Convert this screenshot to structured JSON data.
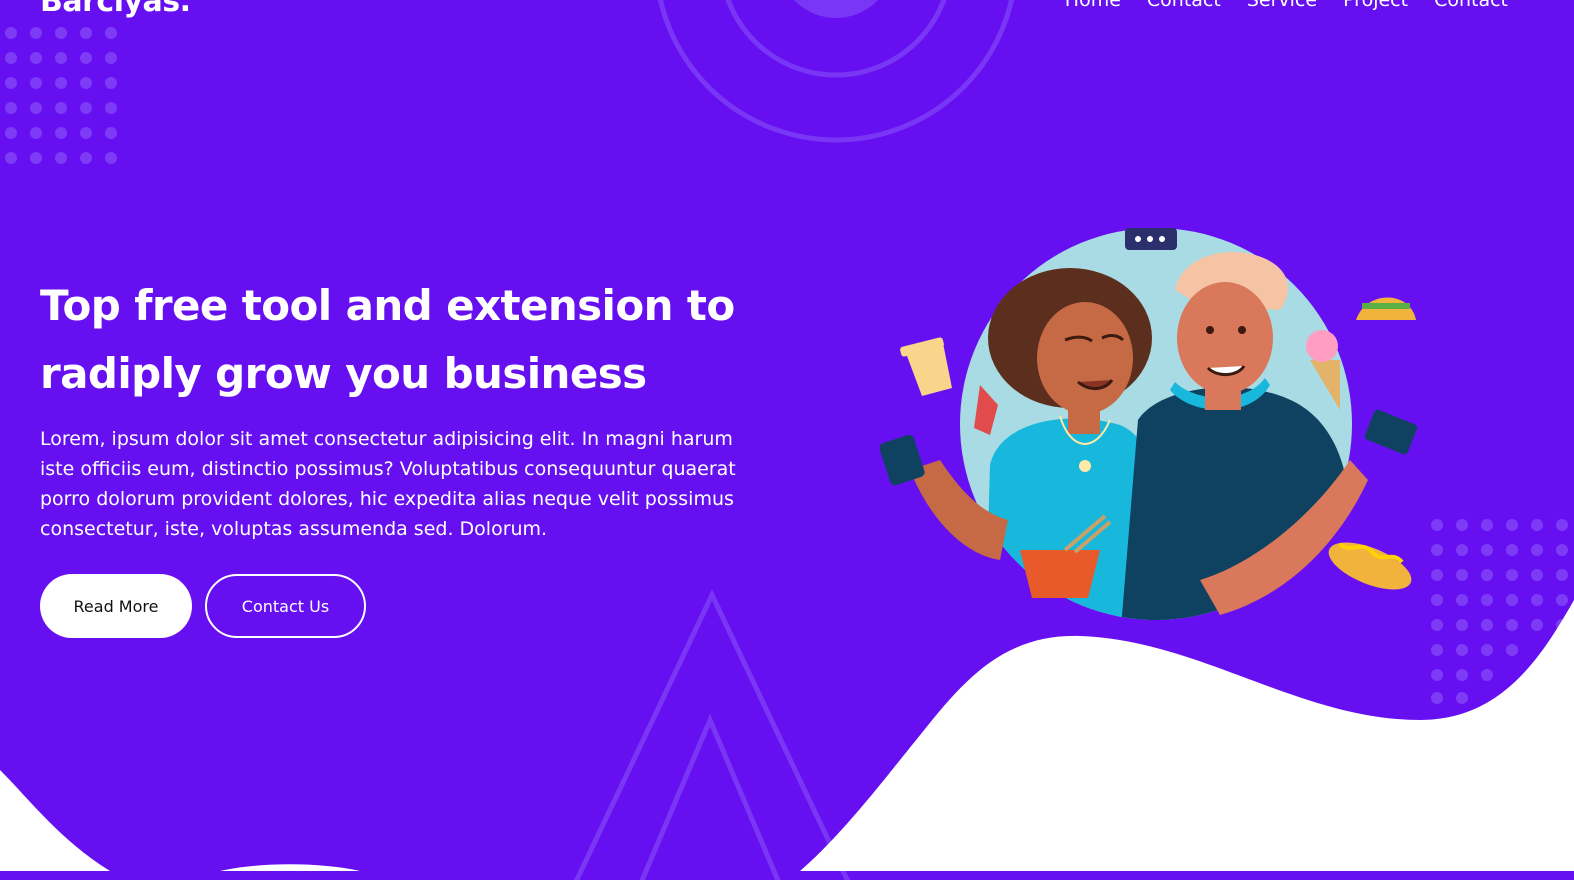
{
  "header": {
    "logo": "Barclyas.",
    "nav": [
      "Home",
      "Contact",
      "Service",
      "Project",
      "Contact"
    ]
  },
  "hero": {
    "title_line1": "Top free tool and extension to",
    "title_line2": "radiply grow you business",
    "body": "Lorem, ipsum dolor sit amet consectetur adipisicing elit. In magni harum iste officiis eum, distinctio possimus? Voluptatibus consequuntur quaerat porro dolorum provident dolores, hic expedita alias neque velit possimus consectetur, iste, voluptas assumenda sed. Dolorum.",
    "read_more": "Read More",
    "contact_us": "Contact Us"
  },
  "colors": {
    "background": "#6610f2",
    "accent_light": "#7a36f5",
    "white": "#ffffff"
  }
}
